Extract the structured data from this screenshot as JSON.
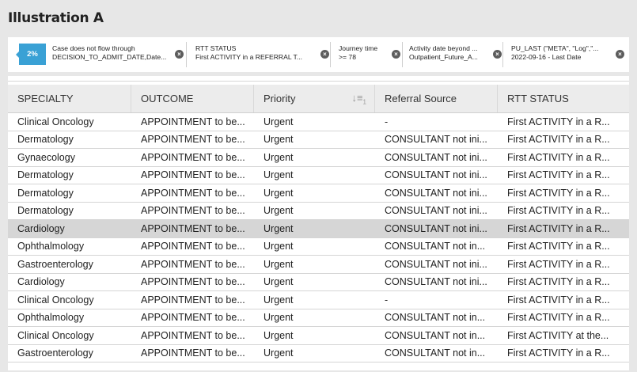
{
  "page": {
    "title": "Illustration A"
  },
  "filters": {
    "percent": "2%",
    "chips": [
      {
        "line1": "Case does not flow through",
        "line2": "DECISION_TO_ADMIT_DATE,Date..."
      },
      {
        "line1": "RTT STATUS",
        "line2": "First ACTIVITY in a REFERRAL T..."
      },
      {
        "line1": "Journey time",
        "line2": ">= 78"
      },
      {
        "line1": "Activity date beyond ...",
        "line2": "Outpatient_Future_A..."
      },
      {
        "line1": "PU_LAST (\"META\", \"Log\",\"...",
        "line2": "2022-09-16 - Last Date"
      }
    ]
  },
  "table": {
    "columns": [
      "SPECIALTY",
      "OUTCOME",
      "Priority",
      "Referral Source",
      "RTT STATUS"
    ],
    "sort_indicator": "1",
    "rows": [
      [
        "Clinical Oncology",
        "APPOINTMENT to be...",
        "Urgent",
        "-",
        "First ACTIVITY in a R..."
      ],
      [
        "Dermatology",
        "APPOINTMENT to be...",
        "Urgent",
        "CONSULTANT not ini...",
        "First ACTIVITY in a R..."
      ],
      [
        "Gynaecology",
        "APPOINTMENT to be...",
        "Urgent",
        "CONSULTANT not ini...",
        "First ACTIVITY in a R..."
      ],
      [
        "Dermatology",
        "APPOINTMENT to be...",
        "Urgent",
        "CONSULTANT not ini...",
        "First ACTIVITY in a R..."
      ],
      [
        "Dermatology",
        "APPOINTMENT to be...",
        "Urgent",
        "CONSULTANT not ini...",
        "First ACTIVITY in a R..."
      ],
      [
        "Dermatology",
        "APPOINTMENT to be...",
        "Urgent",
        "CONSULTANT not ini...",
        "First ACTIVITY in a R..."
      ],
      [
        "Cardiology",
        "APPOINTMENT to be...",
        "Urgent",
        "CONSULTANT not ini...",
        "First ACTIVITY in a R..."
      ],
      [
        "Ophthalmology",
        "APPOINTMENT to be...",
        "Urgent",
        "CONSULTANT  not in...",
        "First ACTIVITY in a R..."
      ],
      [
        "Gastroenterology",
        "APPOINTMENT to be...",
        "Urgent",
        "CONSULTANT not ini...",
        "First ACTIVITY in a R..."
      ],
      [
        "Cardiology",
        "APPOINTMENT to be...",
        "Urgent",
        "CONSULTANT not ini...",
        "First ACTIVITY in a R..."
      ],
      [
        "Clinical Oncology",
        "APPOINTMENT to be...",
        "Urgent",
        "-",
        "First ACTIVITY in a R..."
      ],
      [
        "Ophthalmology",
        "APPOINTMENT to be...",
        "Urgent",
        "CONSULTANT  not in...",
        "First ACTIVITY in a R..."
      ],
      [
        "Clinical Oncology",
        "APPOINTMENT to be...",
        "Urgent",
        "CONSULTANT  not in...",
        "First ACTIVITY at the..."
      ],
      [
        "Gastroenterology",
        "APPOINTMENT to be...",
        "Urgent",
        "CONSULTANT  not in...",
        "First ACTIVITY in a R..."
      ]
    ],
    "selected_row": 6
  },
  "icons": {
    "remove_filter": "close-circle-icon",
    "sort": "sort-descending-icon"
  }
}
